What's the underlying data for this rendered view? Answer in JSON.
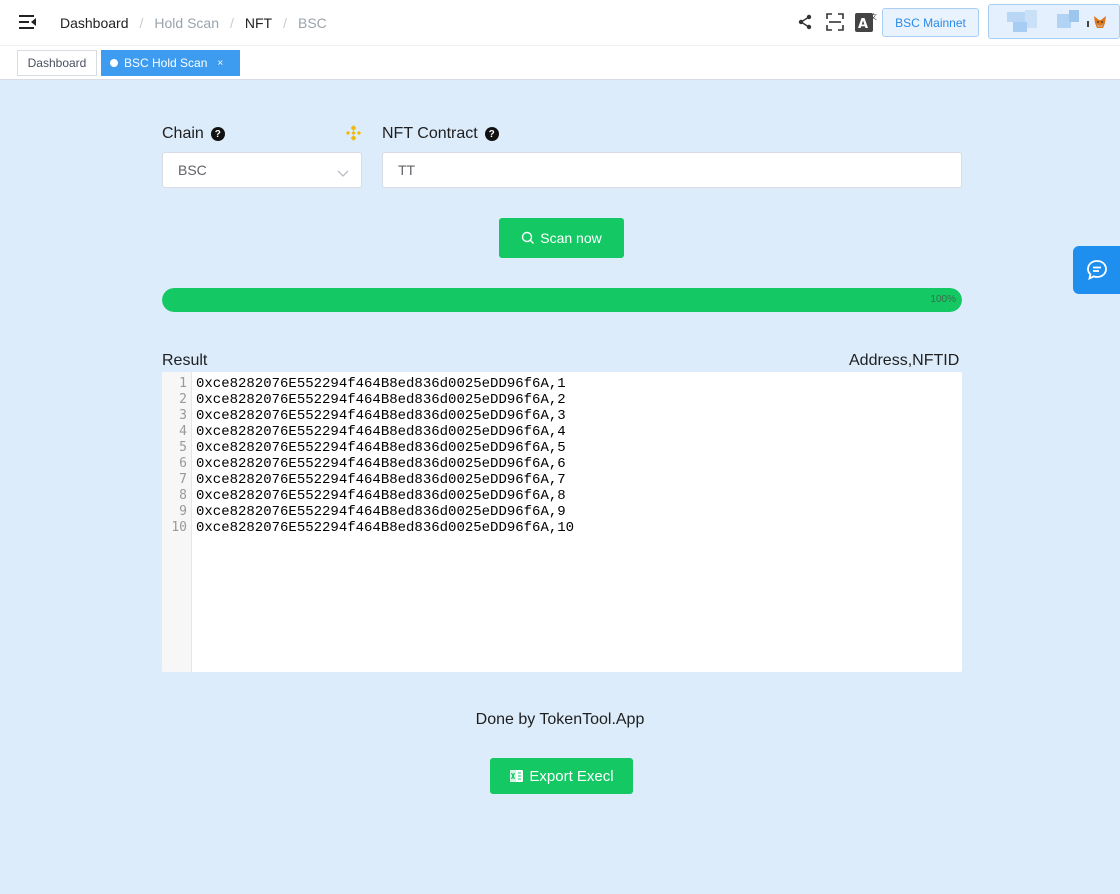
{
  "header": {
    "breadcrumb": [
      {
        "label": "Dashboard",
        "muted": false
      },
      {
        "label": "Hold Scan",
        "muted": true
      },
      {
        "label": "NFT",
        "muted": false
      },
      {
        "label": "BSC",
        "muted": true
      }
    ],
    "separator": "/",
    "network_label": "BSC Mainnet",
    "icons": [
      "menu-fold-icon",
      "share-icon",
      "fullscreen-icon",
      "translate-icon",
      "metamask-fox-icon"
    ]
  },
  "tabs": [
    {
      "label": "Dashboard",
      "active": false
    },
    {
      "label": "BSC Hold Scan",
      "active": true,
      "close": "×"
    }
  ],
  "form": {
    "chain_label": "Chain",
    "chain_value": "BSC",
    "contract_label": "NFT Contract",
    "contract_value": "TT",
    "help_glyph": "?"
  },
  "scan_button_label": "Scan now",
  "progress": {
    "percent": 100,
    "label": "100%"
  },
  "result": {
    "title": "Result",
    "format_hint": "Address,NFTID",
    "lines": [
      "0xce8282076E552294f464B8ed836d0025eDD96f6A,1",
      "0xce8282076E552294f464B8ed836d0025eDD96f6A,2",
      "0xce8282076E552294f464B8ed836d0025eDD96f6A,3",
      "0xce8282076E552294f464B8ed836d0025eDD96f6A,4",
      "0xce8282076E552294f464B8ed836d0025eDD96f6A,5",
      "0xce8282076E552294f464B8ed836d0025eDD96f6A,6",
      "0xce8282076E552294f464B8ed836d0025eDD96f6A,7",
      "0xce8282076E552294f464B8ed836d0025eDD96f6A,8",
      "0xce8282076E552294f464B8ed836d0025eDD96f6A,9",
      "0xce8282076E552294f464B8ed836d0025eDD96f6A,10"
    ]
  },
  "footer_text": "Done by TokenTool.App",
  "export_button_label": "Export Execl",
  "colors": {
    "primary_green": "#14c964",
    "accent_blue": "#3d9cf0",
    "page_bg": "#dcecfb",
    "binance_yellow": "#f0b90b"
  }
}
